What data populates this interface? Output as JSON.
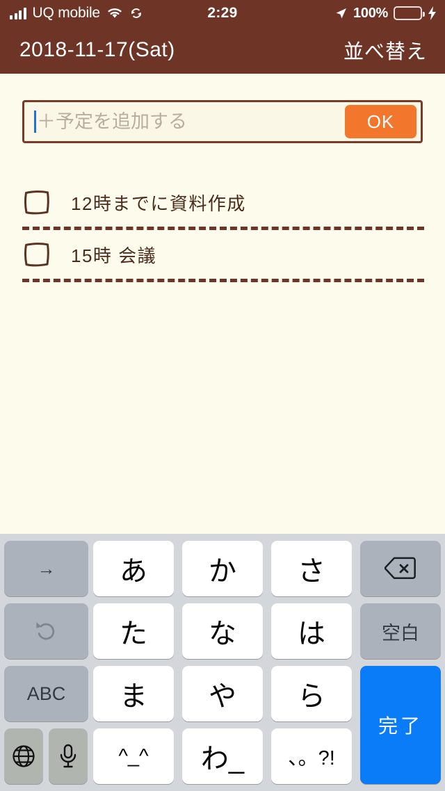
{
  "status_bar": {
    "carrier": "UQ mobile",
    "time": "2:29",
    "battery_percent": "100%",
    "icons": [
      "signal-bars-icon",
      "wifi-icon",
      "rotation-lock-icon",
      "location-arrow-icon",
      "battery-icon",
      "charging-bolt-icon"
    ]
  },
  "header": {
    "date": "2018-11-17(Sat)",
    "sort_label": "並べ替え"
  },
  "input": {
    "placeholder": "＋予定を追加する",
    "value": "",
    "ok_label": "OK"
  },
  "tasks": [
    {
      "text": "12時までに資料作成",
      "checked": false
    },
    {
      "text": "15時 会議",
      "checked": false
    }
  ],
  "keyboard": {
    "keys": {
      "arrow_right": "→",
      "undo": "↺",
      "abc": "ABC",
      "globe": "globe-icon",
      "mic": "mic-icon",
      "a": "あ",
      "ka": "か",
      "sa": "さ",
      "ta": "た",
      "na": "な",
      "ha": "は",
      "ma": "ま",
      "ya": "や",
      "ra": "ら",
      "emoticon": "^_^",
      "wa": "わ_",
      "punctuation": "、。?!",
      "delete": "delete-icon",
      "space": "空白",
      "done": "完了"
    }
  },
  "colors": {
    "header_brown": "#6E3426",
    "page_cream": "#FDFBEC",
    "ok_orange": "#F2762C",
    "done_blue": "#0A7CF7",
    "battery_green": "#4CD763"
  }
}
